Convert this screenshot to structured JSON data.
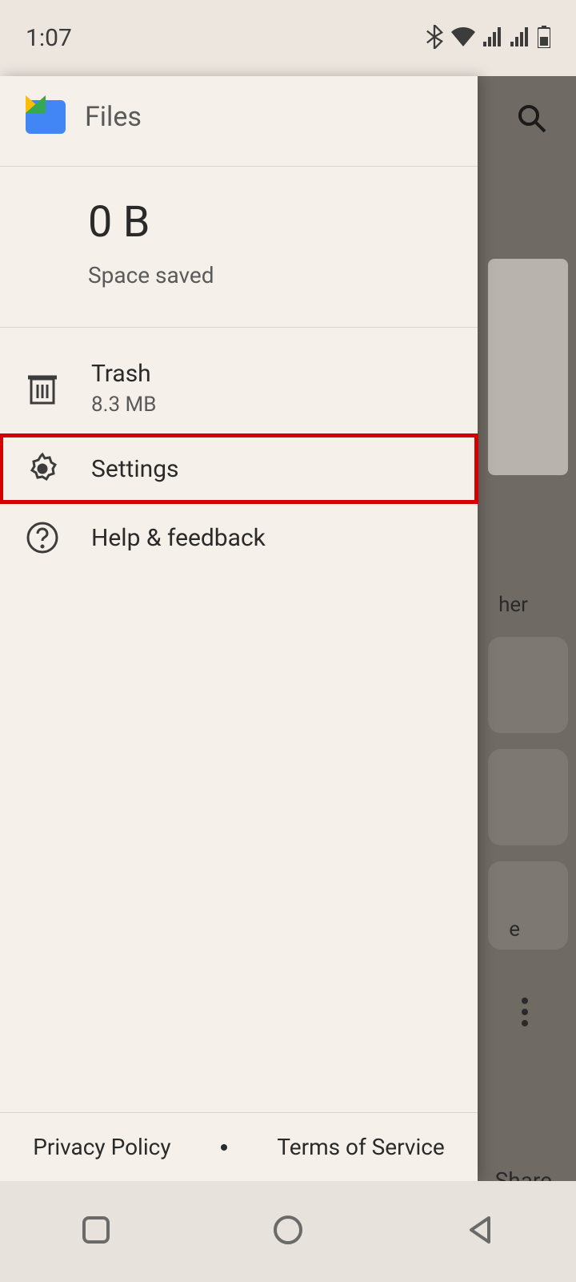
{
  "status": {
    "time": "1:07"
  },
  "drawer": {
    "title": "Files",
    "space": {
      "value": "0 B",
      "label": "Space saved"
    },
    "items": [
      {
        "label": "Trash",
        "sub": "8.3 MB"
      },
      {
        "label": "Settings"
      },
      {
        "label": "Help & feedback"
      }
    ],
    "footer": {
      "privacy": "Privacy Policy",
      "terms": "Terms of Service"
    }
  },
  "background": {
    "partial1": "her",
    "partial2": "e",
    "share": "Share"
  }
}
